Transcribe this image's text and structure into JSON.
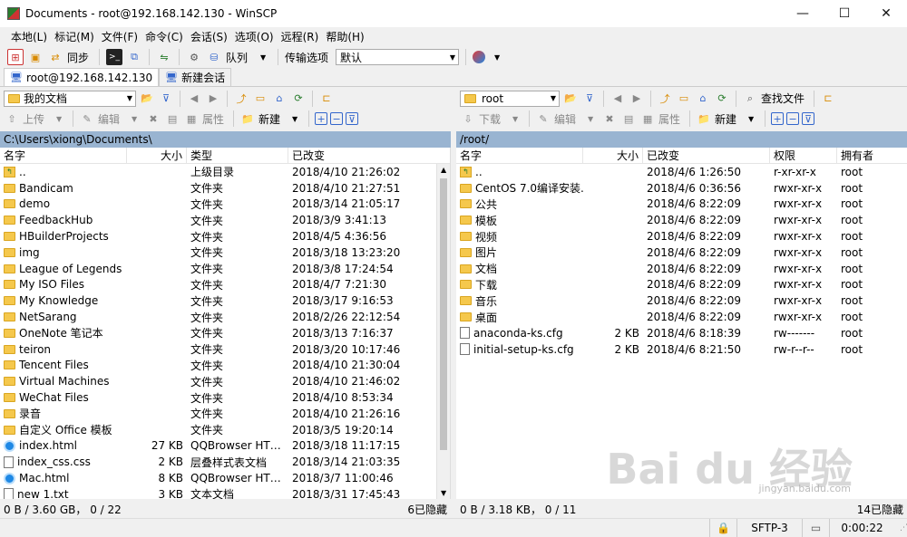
{
  "window": {
    "title": "Documents - root@192.168.142.130 - WinSCP",
    "min": "—",
    "max": "☐",
    "close": "✕"
  },
  "menu": [
    "本地(L)",
    "标记(M)",
    "文件(F)",
    "命令(C)",
    "会话(S)",
    "选项(O)",
    "远程(R)",
    "帮助(H)"
  ],
  "toolbar": {
    "sync": "同步",
    "queue": "队列",
    "transfer_label": "传输选项",
    "transfer_value": "默认"
  },
  "tabs": [
    "root@192.168.142.130",
    "新建会话"
  ],
  "left": {
    "dir_combo": "我的文档",
    "upload": "上传",
    "edit": "编辑",
    "props": "属性",
    "new": "新建",
    "path": "C:\\Users\\xiong\\Documents\\",
    "headers": [
      "名字",
      "大小",
      "类型",
      "已改变"
    ],
    "rows": [
      {
        "icon": "up",
        "name": "..",
        "size": "",
        "type": "上级目录",
        "date": "2018/4/10  21:26:02"
      },
      {
        "icon": "folder",
        "name": "Bandicam",
        "size": "",
        "type": "文件夹",
        "date": "2018/4/10  21:27:51"
      },
      {
        "icon": "folder",
        "name": "demo",
        "size": "",
        "type": "文件夹",
        "date": "2018/3/14  21:05:17"
      },
      {
        "icon": "folder",
        "name": "FeedbackHub",
        "size": "",
        "type": "文件夹",
        "date": "2018/3/9  3:41:13"
      },
      {
        "icon": "folder",
        "name": "HBuilderProjects",
        "size": "",
        "type": "文件夹",
        "date": "2018/4/5  4:36:56"
      },
      {
        "icon": "folder",
        "name": "img",
        "size": "",
        "type": "文件夹",
        "date": "2018/3/18  13:23:20"
      },
      {
        "icon": "folder",
        "name": "League of Legends",
        "size": "",
        "type": "文件夹",
        "date": "2018/3/8  17:24:54"
      },
      {
        "icon": "folder",
        "name": "My ISO Files",
        "size": "",
        "type": "文件夹",
        "date": "2018/4/7  7:21:30"
      },
      {
        "icon": "folder",
        "name": "My Knowledge",
        "size": "",
        "type": "文件夹",
        "date": "2018/3/17  9:16:53"
      },
      {
        "icon": "folder",
        "name": "NetSarang",
        "size": "",
        "type": "文件夹",
        "date": "2018/2/26  22:12:54"
      },
      {
        "icon": "folder",
        "name": "OneNote 笔记本",
        "size": "",
        "type": "文件夹",
        "date": "2018/3/13  7:16:37"
      },
      {
        "icon": "folder",
        "name": "teiron",
        "size": "",
        "type": "文件夹",
        "date": "2018/3/20  10:17:46"
      },
      {
        "icon": "folder",
        "name": "Tencent Files",
        "size": "",
        "type": "文件夹",
        "date": "2018/4/10  21:30:04"
      },
      {
        "icon": "folder",
        "name": "Virtual Machines",
        "size": "",
        "type": "文件夹",
        "date": "2018/4/10  21:46:02"
      },
      {
        "icon": "folder",
        "name": "WeChat Files",
        "size": "",
        "type": "文件夹",
        "date": "2018/4/10  8:53:34"
      },
      {
        "icon": "folder",
        "name": "录音",
        "size": "",
        "type": "文件夹",
        "date": "2018/4/10  21:26:16"
      },
      {
        "icon": "folder",
        "name": "自定义 Office 模板",
        "size": "",
        "type": "文件夹",
        "date": "2018/3/5  19:20:14"
      },
      {
        "icon": "browser",
        "name": "index.html",
        "size": "27 KB",
        "type": "QQBrowser HTM...",
        "date": "2018/3/18  11:17:15"
      },
      {
        "icon": "file",
        "name": "index_css.css",
        "size": "2 KB",
        "type": "层叠样式表文档",
        "date": "2018/3/14  21:03:35"
      },
      {
        "icon": "browser",
        "name": "Mac.html",
        "size": "8 KB",
        "type": "QQBrowser HTM...",
        "date": "2018/3/7  11:00:46"
      },
      {
        "icon": "file",
        "name": "new 1.txt",
        "size": "3 KB",
        "type": "文本文档",
        "date": "2018/3/31  17:45:43"
      }
    ],
    "status_left": "0 B / 3.60 GB，  0 / 22",
    "status_right": "6已隐藏"
  },
  "right": {
    "dir_combo": "root",
    "download": "下载",
    "edit": "编辑",
    "props": "属性",
    "new": "新建",
    "find": "查找文件",
    "path": "/root/",
    "headers": [
      "名字",
      "大小",
      "已改变",
      "权限",
      "拥有者"
    ],
    "rows": [
      {
        "icon": "up",
        "name": "..",
        "size": "",
        "date": "2018/4/6  1:26:50",
        "perm": "r-xr-xr-x",
        "owner": "root"
      },
      {
        "icon": "folder",
        "name": "CentOS 7.0编译安装...",
        "size": "",
        "date": "2018/4/6  0:36:56",
        "perm": "rwxr-xr-x",
        "owner": "root"
      },
      {
        "icon": "folder",
        "name": "公共",
        "size": "",
        "date": "2018/4/6  8:22:09",
        "perm": "rwxr-xr-x",
        "owner": "root"
      },
      {
        "icon": "folder",
        "name": "模板",
        "size": "",
        "date": "2018/4/6  8:22:09",
        "perm": "rwxr-xr-x",
        "owner": "root"
      },
      {
        "icon": "folder",
        "name": "视频",
        "size": "",
        "date": "2018/4/6  8:22:09",
        "perm": "rwxr-xr-x",
        "owner": "root"
      },
      {
        "icon": "folder",
        "name": "图片",
        "size": "",
        "date": "2018/4/6  8:22:09",
        "perm": "rwxr-xr-x",
        "owner": "root"
      },
      {
        "icon": "folder",
        "name": "文档",
        "size": "",
        "date": "2018/4/6  8:22:09",
        "perm": "rwxr-xr-x",
        "owner": "root"
      },
      {
        "icon": "folder",
        "name": "下载",
        "size": "",
        "date": "2018/4/6  8:22:09",
        "perm": "rwxr-xr-x",
        "owner": "root"
      },
      {
        "icon": "folder",
        "name": "音乐",
        "size": "",
        "date": "2018/4/6  8:22:09",
        "perm": "rwxr-xr-x",
        "owner": "root"
      },
      {
        "icon": "folder",
        "name": "桌面",
        "size": "",
        "date": "2018/4/6  8:22:09",
        "perm": "rwxr-xr-x",
        "owner": "root"
      },
      {
        "icon": "file",
        "name": "anaconda-ks.cfg",
        "size": "2 KB",
        "date": "2018/4/6  8:18:39",
        "perm": "rw-------",
        "owner": "root"
      },
      {
        "icon": "file",
        "name": "initial-setup-ks.cfg",
        "size": "2 KB",
        "date": "2018/4/6  8:21:50",
        "perm": "rw-r--r--",
        "owner": "root"
      }
    ],
    "status_left": "0 B / 3.18 KB，  0 / 11",
    "status_right": "14已隐藏"
  },
  "bottom": {
    "protocol": "SFTP-3",
    "time": "0:00:22"
  },
  "watermark": {
    "logo": "Bai du 经验",
    "url": "jingyan.baidu.com"
  }
}
